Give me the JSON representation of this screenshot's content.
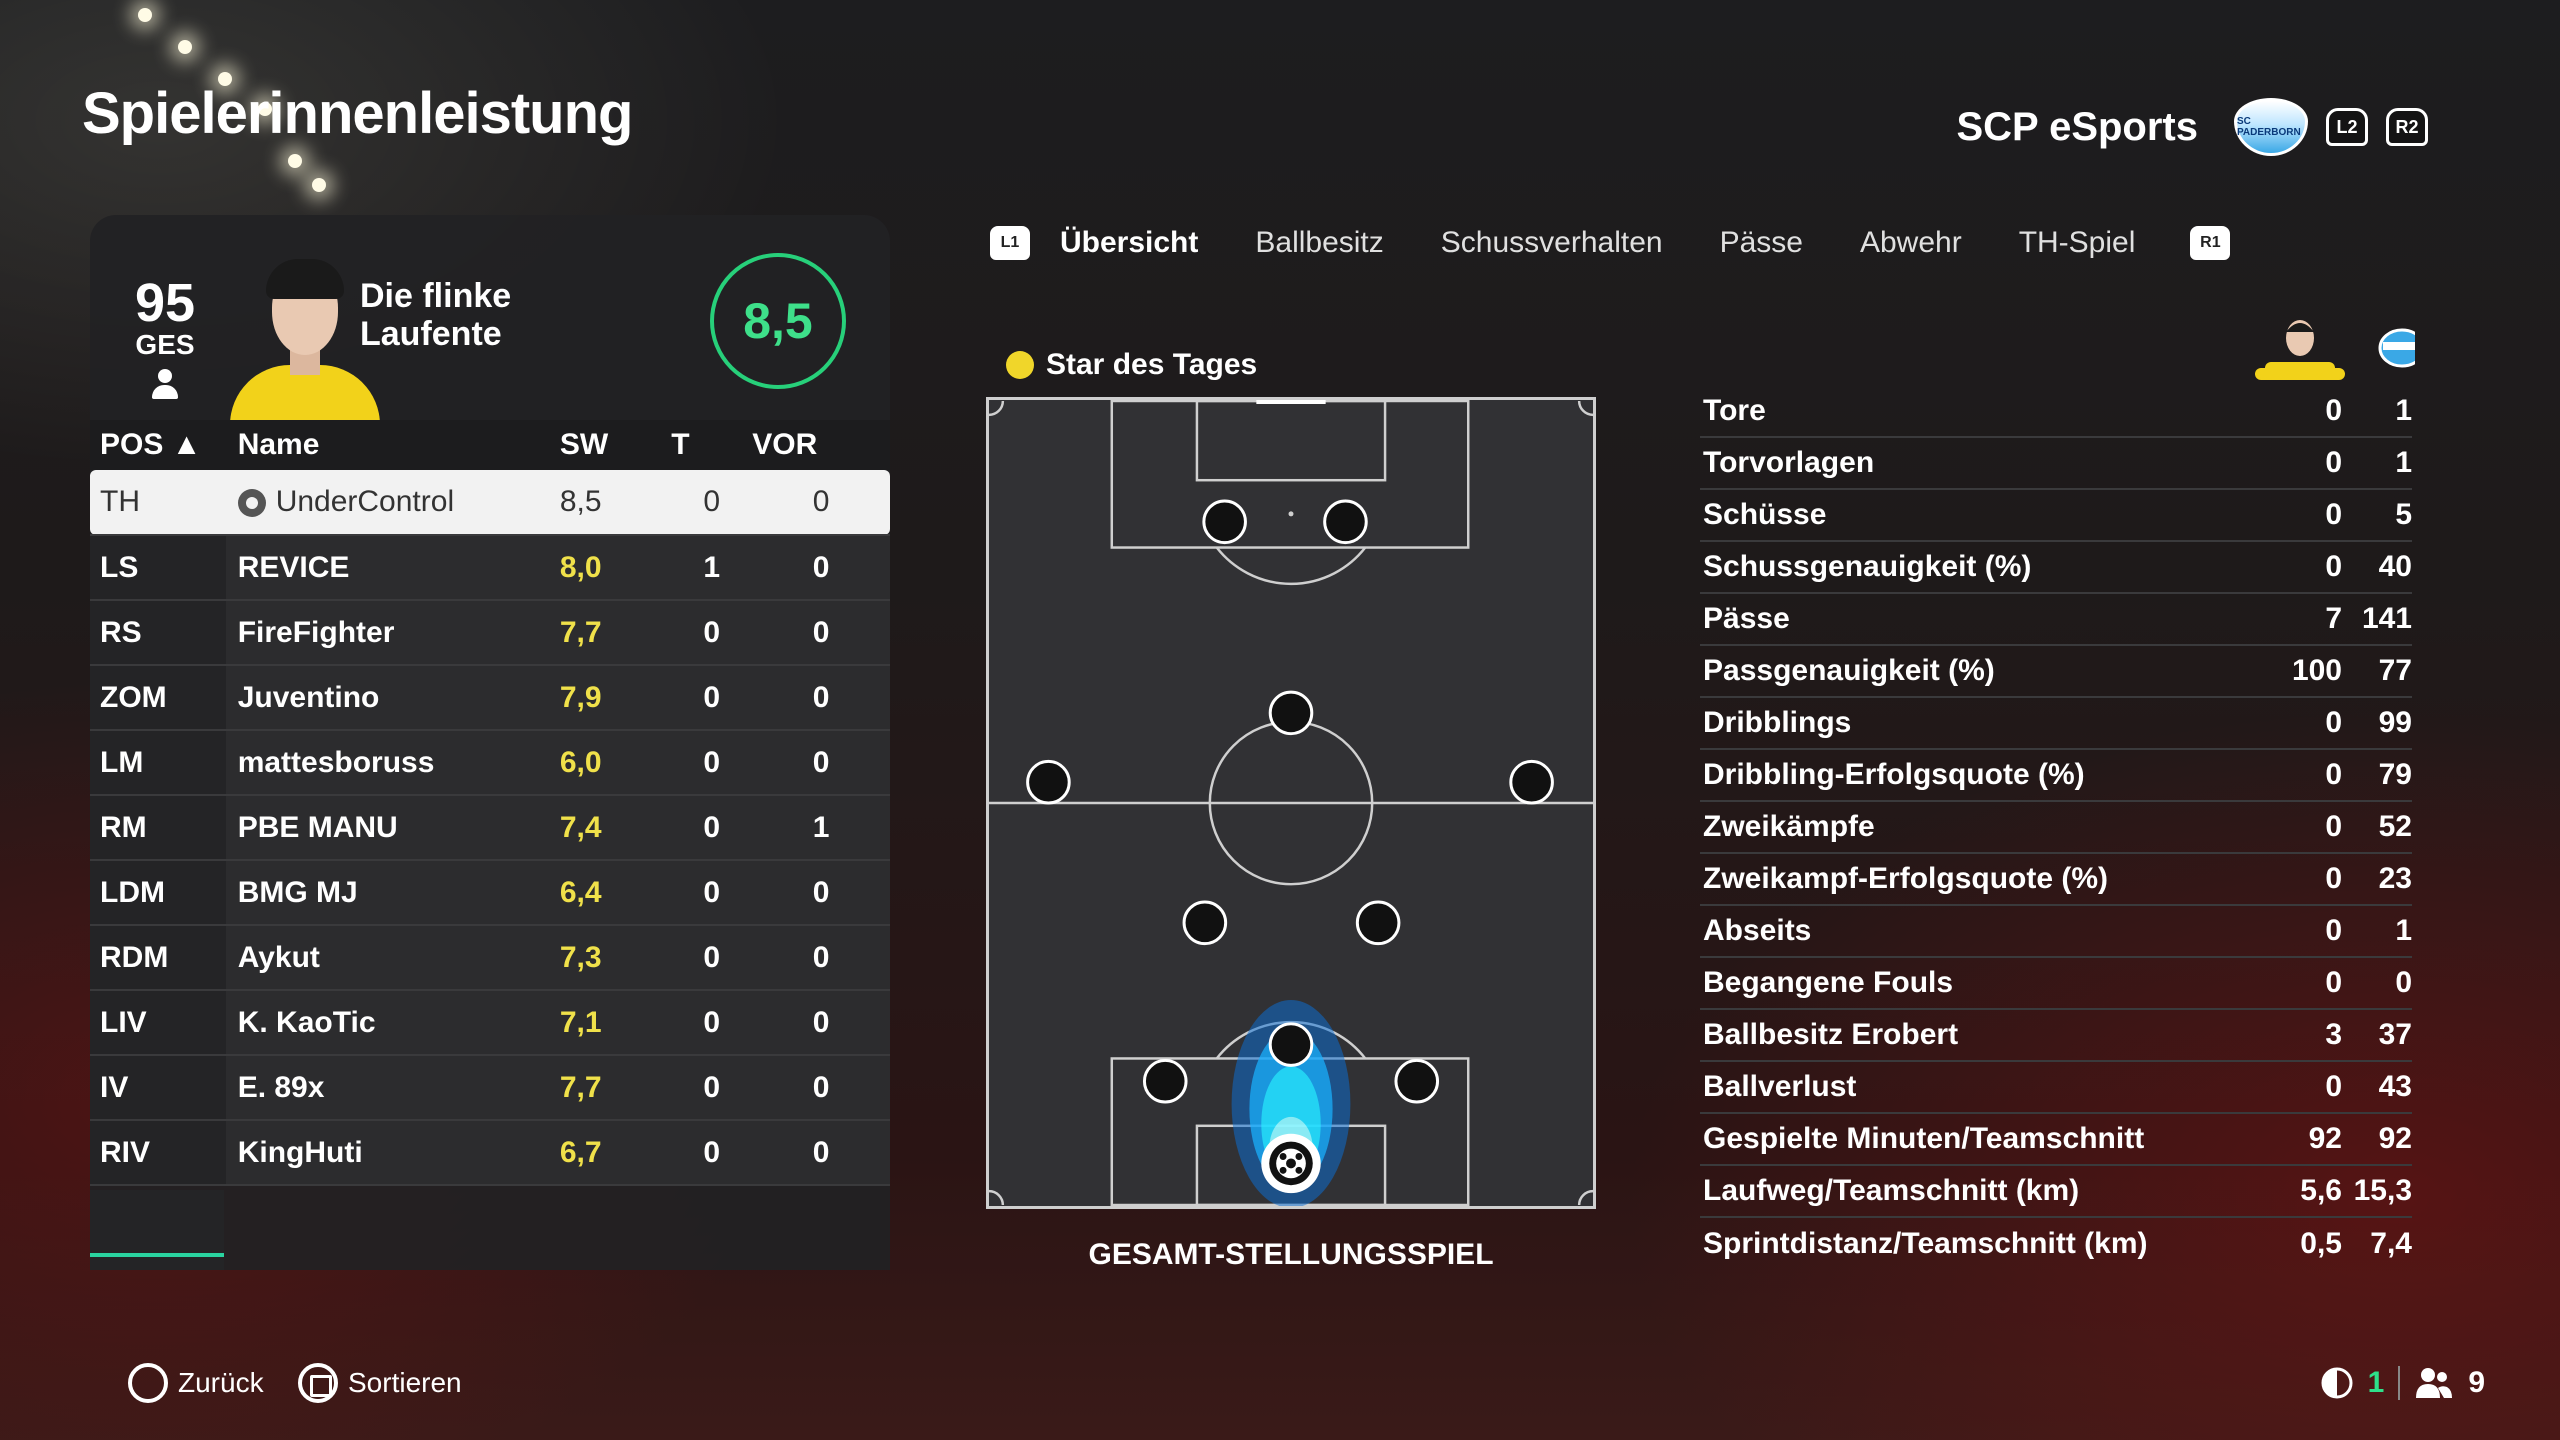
{
  "header": {
    "title": "Spielerinnenleistung",
    "team_name": "SCP eSports",
    "crest_label": "SC PADERBORN",
    "l2": "L2",
    "r2": "R2"
  },
  "player_card": {
    "overall": "95",
    "overall_label": "GES",
    "nickname": "Die flinke Laufente",
    "rating": "8,5"
  },
  "roster": {
    "headers": {
      "pos": "POS ▲",
      "name": "Name",
      "sw": "SW",
      "t": "T",
      "vor": "VOR"
    },
    "rows": [
      {
        "pos": "TH",
        "name": "UnderControl",
        "sw": "8,5",
        "t": "0",
        "vor": "0"
      },
      {
        "pos": "LS",
        "name": "REVICE",
        "sw": "8,0",
        "t": "1",
        "vor": "0"
      },
      {
        "pos": "RS",
        "name": "FireFighter",
        "sw": "7,7",
        "t": "0",
        "vor": "0"
      },
      {
        "pos": "ZOM",
        "name": "Juventino",
        "sw": "7,9",
        "t": "0",
        "vor": "0"
      },
      {
        "pos": "LM",
        "name": "mattesboruss",
        "sw": "6,0",
        "t": "0",
        "vor": "0"
      },
      {
        "pos": "RM",
        "name": "PBE MANU",
        "sw": "7,4",
        "t": "0",
        "vor": "1"
      },
      {
        "pos": "LDM",
        "name": "BMG MJ",
        "sw": "6,4",
        "t": "0",
        "vor": "0"
      },
      {
        "pos": "RDM",
        "name": "Aykut",
        "sw": "7,3",
        "t": "0",
        "vor": "0"
      },
      {
        "pos": "LIV",
        "name": "K. KaoTic",
        "sw": "7,1",
        "t": "0",
        "vor": "0"
      },
      {
        "pos": "IV",
        "name": "E. 89x",
        "sw": "7,7",
        "t": "0",
        "vor": "0"
      },
      {
        "pos": "RIV",
        "name": "KingHuti",
        "sw": "6,7",
        "t": "0",
        "vor": "0"
      }
    ]
  },
  "tabs": {
    "l1": "L1",
    "r1": "R1",
    "items": [
      "Übersicht",
      "Ballbesitz",
      "Schussverhalten",
      "Pässe",
      "Abwehr",
      "TH-Spiel"
    ]
  },
  "pitch": {
    "star_label": "Star des Tages",
    "title": "GESAMT-STELLUNGSSPIEL"
  },
  "stats": {
    "rows": [
      {
        "label": "Tore",
        "player": "0",
        "team": "1"
      },
      {
        "label": "Torvorlagen",
        "player": "0",
        "team": "1"
      },
      {
        "label": "Schüsse",
        "player": "0",
        "team": "5"
      },
      {
        "label": "Schussgenauigkeit (%)",
        "player": "0",
        "team": "40"
      },
      {
        "label": "Pässe",
        "player": "7",
        "team": "141"
      },
      {
        "label": "Passgenauigkeit (%)",
        "player": "100",
        "team": "77"
      },
      {
        "label": "Dribblings",
        "player": "0",
        "team": "99"
      },
      {
        "label": "Dribbling-Erfolgsquote (%)",
        "player": "0",
        "team": "79"
      },
      {
        "label": "Zweikämpfe",
        "player": "0",
        "team": "52"
      },
      {
        "label": "Zweikampf-Erfolgsquote (%)",
        "player": "0",
        "team": "23"
      },
      {
        "label": "Abseits",
        "player": "0",
        "team": "1"
      },
      {
        "label": "Begangene Fouls",
        "player": "0",
        "team": "0"
      },
      {
        "label": "Ballbesitz Erobert",
        "player": "3",
        "team": "37"
      },
      {
        "label": "Ballverlust",
        "player": "0",
        "team": "43"
      },
      {
        "label": "Gespielte Minuten/Teamschnitt",
        "player": "92",
        "team": "92"
      },
      {
        "label": "Laufweg/Teamschnitt (km)",
        "player": "5,6",
        "team": "15,3"
      },
      {
        "label": "Sprintdistanz/Teamschnitt (km)",
        "player": "0,5",
        "team": "7,4"
      }
    ]
  },
  "footer": {
    "back": "Zurück",
    "sort": "Sortieren",
    "count_a": "1",
    "count_b": "9"
  },
  "colors": {
    "rating_green": "#27d07a",
    "rating_yellow": "#f0e14a",
    "accent_teal": "#2ad4a0",
    "heatmap_cyan": "#19d4ff"
  }
}
